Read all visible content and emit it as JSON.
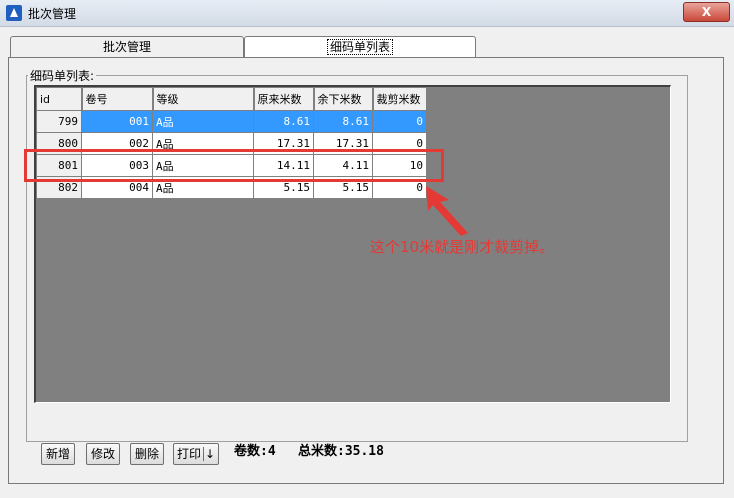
{
  "window": {
    "title": "批次管理",
    "close_label": "X"
  },
  "tabs": [
    {
      "label": "批次管理"
    },
    {
      "label": "细码单列表"
    }
  ],
  "group": {
    "label": "细码单列表:"
  },
  "table": {
    "headers": [
      "id",
      "卷号",
      "等级",
      "原来米数",
      "余下米数",
      "裁剪米数"
    ],
    "rows": [
      [
        "799",
        "001",
        "A品",
        "8.61",
        "8.61",
        "0"
      ],
      [
        "800",
        "002",
        "A品",
        "17.31",
        "17.31",
        "0"
      ],
      [
        "801",
        "003",
        "A品",
        "14.11",
        "4.11",
        "10"
      ],
      [
        "802",
        "004",
        "A品",
        "5.15",
        "5.15",
        "0"
      ]
    ]
  },
  "annotation": {
    "text": "这个10米就是刚才裁剪掉。",
    "color": "#e53935"
  },
  "buttons": {
    "add": "新增",
    "edit": "修改",
    "delete": "删除",
    "print": "打印",
    "print_arrow": "↓"
  },
  "stats": {
    "rolls": "卷数:4",
    "total": "总米数:35.18"
  }
}
